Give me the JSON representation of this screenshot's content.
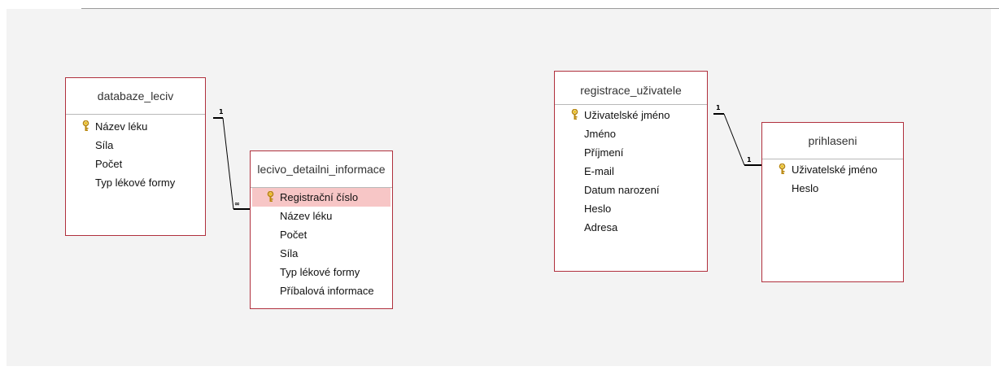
{
  "tables": [
    {
      "title": "databaze_leciv",
      "fields": [
        {
          "label": "Název léku",
          "key": true
        },
        {
          "label": "Síla",
          "key": false
        },
        {
          "label": "Počet",
          "key": false
        },
        {
          "label": "Typ lékové formy",
          "key": false
        }
      ]
    },
    {
      "title": "lecivo_detailni_informace",
      "fields": [
        {
          "label": "Registrační číslo",
          "key": true,
          "selected": true
        },
        {
          "label": "Název léku",
          "key": false
        },
        {
          "label": "Počet",
          "key": false
        },
        {
          "label": "Síla",
          "key": false
        },
        {
          "label": "Typ lékové formy",
          "key": false
        },
        {
          "label": "Příbalová informace",
          "key": false
        }
      ]
    },
    {
      "title": "registrace_uživatele",
      "fields": [
        {
          "label": "Uživatelské jméno",
          "key": true
        },
        {
          "label": "Jméno",
          "key": false
        },
        {
          "label": "Příjmení",
          "key": false
        },
        {
          "label": "E-mail",
          "key": false
        },
        {
          "label": "Datum narození",
          "key": false
        },
        {
          "label": "Heslo",
          "key": false
        },
        {
          "label": "Adresa",
          "key": false
        }
      ]
    },
    {
      "title": "prihlaseni",
      "fields": [
        {
          "label": "Uživatelské jméno",
          "key": true
        },
        {
          "label": "Heslo",
          "key": false
        }
      ]
    }
  ],
  "relationships": [
    {
      "from_label": "1",
      "to_label": "∞"
    },
    {
      "from_label": "1",
      "to_label": "1"
    }
  ],
  "colors": {
    "table_border": "#b0303d",
    "selected_row": "#f7c6c6",
    "canvas": "#f3f3f3",
    "key_icon": "#d4a017"
  },
  "icons": {
    "primary_key": "key-icon"
  }
}
